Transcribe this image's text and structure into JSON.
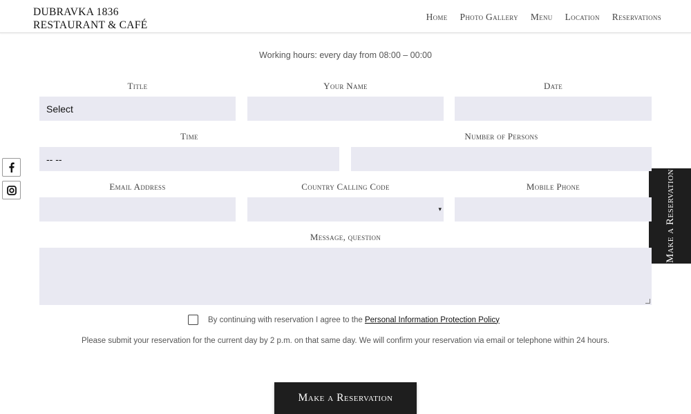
{
  "header": {
    "logo_line1": "DUBRAVKA 1836",
    "logo_line2": "RESTAURANT & CAFÉ",
    "nav": [
      "Home",
      "Photo Gallery",
      "Menu",
      "Location",
      "Reservations"
    ]
  },
  "social": {
    "icons": [
      "facebook-icon",
      "instagram-icon"
    ]
  },
  "side_tab": {
    "label": "Make a Reservation"
  },
  "hours": "Working hours: every day from 08:00 – 00:00",
  "form": {
    "title": {
      "label": "Title",
      "value": "Select"
    },
    "name": {
      "label": "Your Name",
      "value": ""
    },
    "date": {
      "label": "Date",
      "value": ""
    },
    "time": {
      "label": "Time",
      "value": "-- --"
    },
    "persons": {
      "label": "Number of Persons",
      "value": ""
    },
    "email": {
      "label": "Email Address",
      "value": ""
    },
    "country_code": {
      "label": "Country Calling Code",
      "value": ""
    },
    "mobile": {
      "label": "Mobile Phone",
      "value": ""
    },
    "message": {
      "label": "Message, question",
      "value": ""
    }
  },
  "consent": {
    "text": "By continuing with reservation I agree to the",
    "link": "Personal Information Protection Policy",
    "checked": false
  },
  "note": "Please submit your reservation for the current day by 2 p.m. on that same day. We will confirm your reservation via email or telephone within 24 hours.",
  "submit_label": "Make a Reservation",
  "colors": {
    "field_bg": "#e9e9f2",
    "dark": "#1e1e1e"
  }
}
